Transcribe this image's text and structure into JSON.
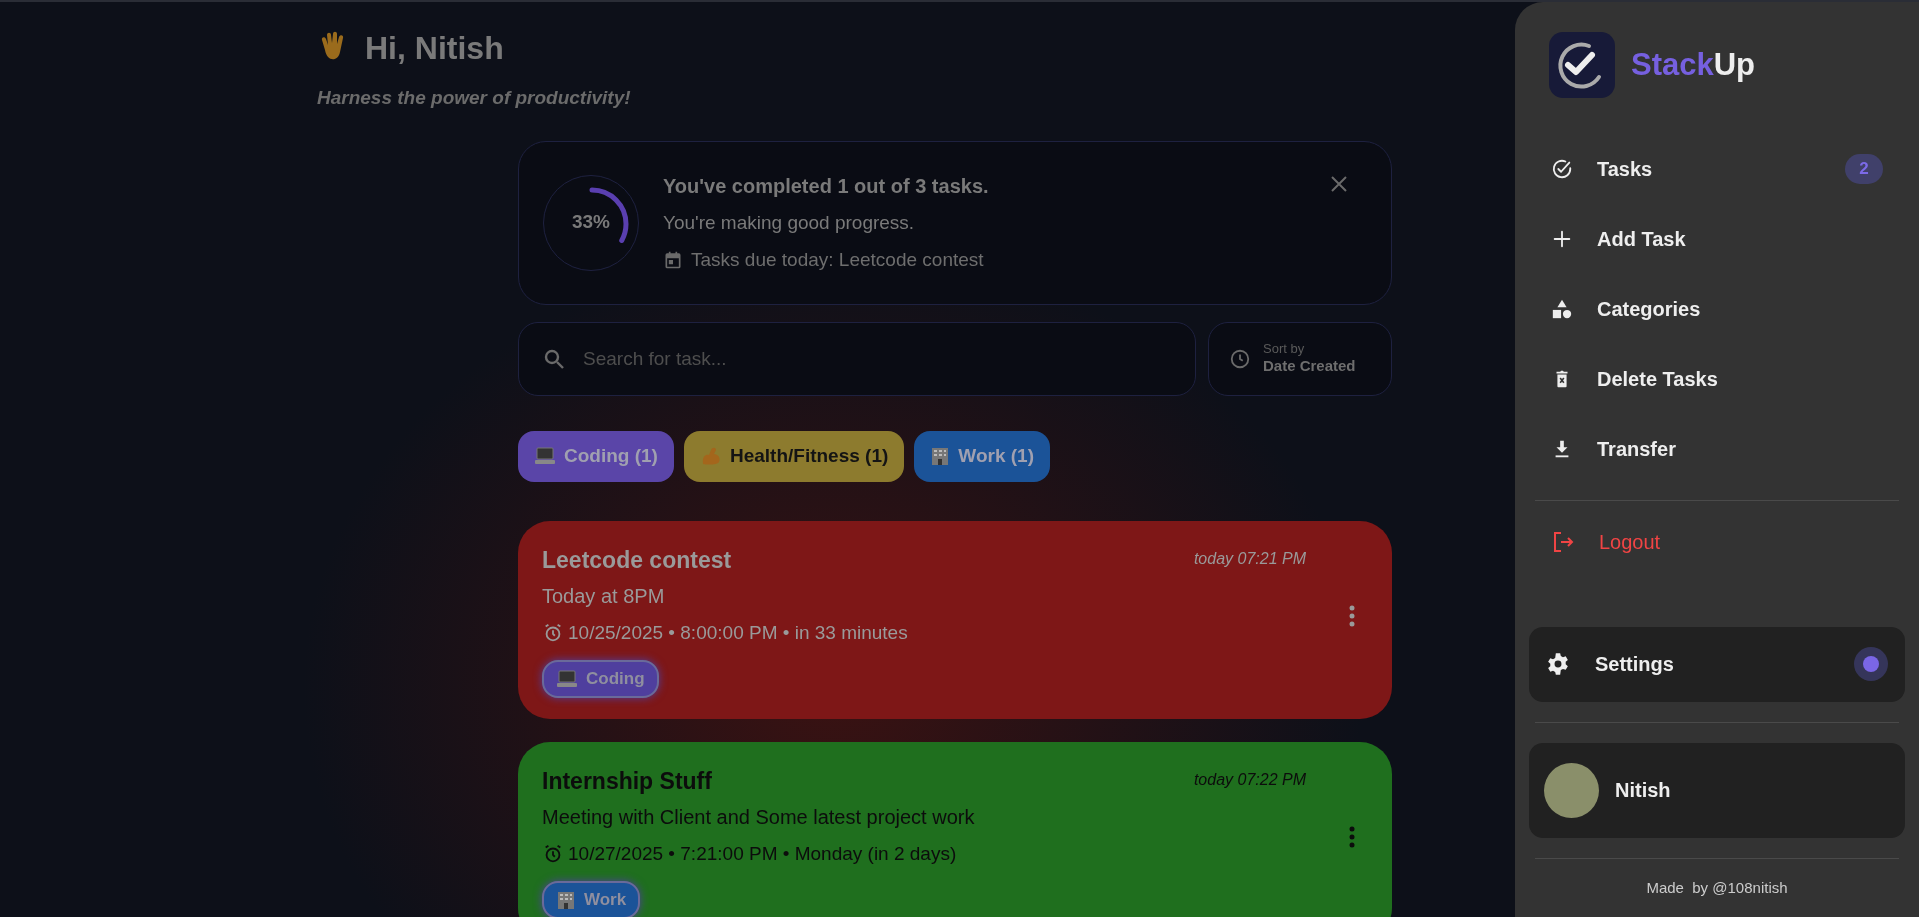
{
  "greeting": {
    "title": "Hi, Nitish",
    "subtitle": "Harness the power of productivity!"
  },
  "progress": {
    "level": 0.33,
    "percent": "33%",
    "headline": "You've completed 1 out of 3 tasks.",
    "message": "You're making good progress.",
    "due": "Tasks due today: Leetcode contest"
  },
  "search": {
    "placeholder": "Search for task..."
  },
  "sort": {
    "label": "Sort by",
    "value": "Date Created"
  },
  "categories": [
    {
      "kind": "laptop",
      "label": "Coding (1)",
      "color": "#5a45a8",
      "dark_text": false
    },
    {
      "kind": "arm",
      "label": "Health/Fitness (1)",
      "color": "#8d7b2e",
      "dark_text": true
    },
    {
      "kind": "building",
      "label": "Work (1)",
      "color": "#1b5398",
      "dark_text": false
    }
  ],
  "tasks": [
    {
      "title": "Leetcode contest",
      "time": "today 07:21 PM",
      "description": "Today at 8PM",
      "deadline": "10/25/2025 • 8:00:00 PM • in 33 minutes",
      "color": "#7e1717",
      "dark_text": false,
      "tag": {
        "kind": "laptop",
        "label": "Coding",
        "color": "#4f3f9e"
      }
    },
    {
      "title": "Internship Stuff",
      "time": "today 07:22 PM",
      "description": "Meeting with Client and Some latest project work",
      "deadline": "10/27/2025 • 7:21:00 PM • Monday (in 2 days)",
      "color": "#1f6f1e",
      "dark_text": true,
      "tag": {
        "kind": "building",
        "label": "Work",
        "color": "#1b5398"
      }
    }
  ],
  "sidebar": {
    "brand_first": "Stack",
    "brand_second": "Up",
    "items": [
      {
        "kind": "check",
        "label": "Tasks",
        "badge": "2"
      },
      {
        "kind": "plus",
        "label": "Add Task"
      },
      {
        "kind": "shapes",
        "label": "Categories"
      },
      {
        "kind": "trash",
        "label": "Delete Tasks"
      },
      {
        "kind": "download",
        "label": "Transfer"
      }
    ],
    "logout": "Logout",
    "settings": "Settings",
    "user": "Nitish",
    "footer": "Made  by @108nitish"
  }
}
